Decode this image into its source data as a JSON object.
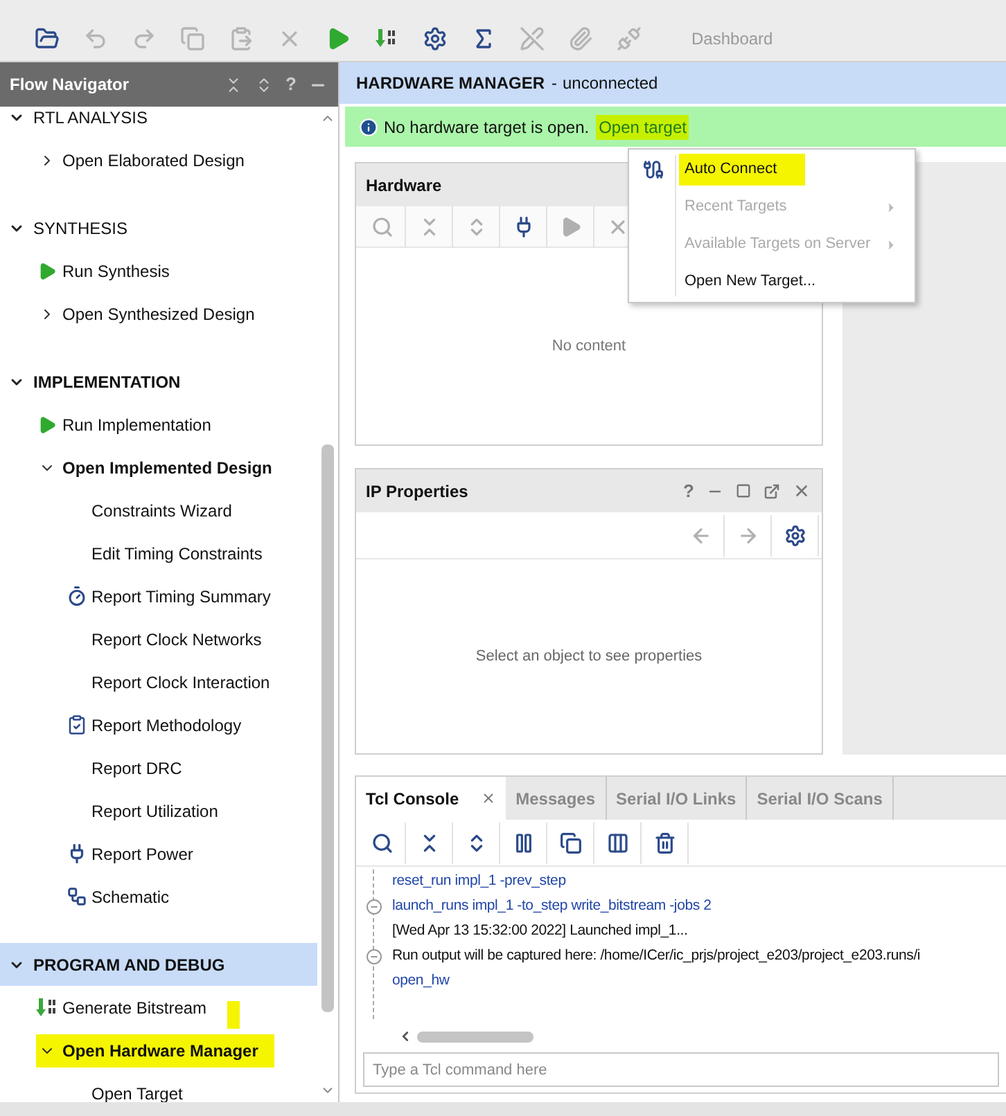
{
  "toolbar": {
    "buttons": [
      {
        "kind": "open",
        "disabled": false
      },
      {
        "kind": "undo",
        "disabled": true
      },
      {
        "kind": "redo",
        "disabled": true
      },
      {
        "kind": "copy",
        "disabled": true
      },
      {
        "kind": "paste",
        "disabled": true
      },
      {
        "kind": "delete",
        "disabled": true
      },
      {
        "kind": "run",
        "disabled": false
      },
      {
        "kind": "bitstream",
        "disabled": false
      },
      {
        "kind": "settings",
        "disabled": false
      },
      {
        "kind": "sum",
        "disabled": false
      },
      {
        "kind": "probe",
        "disabled": true
      },
      {
        "kind": "attach",
        "disabled": true
      },
      {
        "kind": "unplug",
        "disabled": true
      }
    ],
    "layout": "Dashboard"
  },
  "flow_navigator": {
    "title": "Flow Navigator",
    "help": "?",
    "sections": [
      {
        "label": "RTL ANALYSIS",
        "expanded": true,
        "active": false,
        "selected": false,
        "items": [
          {
            "label": "Open Elaborated Design",
            "kind": "group",
            "expanded": false,
            "active": false,
            "highlighted": false
          }
        ]
      },
      {
        "label": "SYNTHESIS",
        "expanded": true,
        "active": false,
        "selected": false,
        "items": [
          {
            "label": "Run Synthesis",
            "kind": "run",
            "active": false,
            "highlighted": false
          },
          {
            "label": "Open Synthesized Design",
            "kind": "group",
            "expanded": false,
            "active": false,
            "highlighted": false
          }
        ]
      },
      {
        "label": "IMPLEMENTATION",
        "expanded": true,
        "active": true,
        "selected": false,
        "items": [
          {
            "label": "Run Implementation",
            "kind": "run",
            "active": false,
            "highlighted": false
          },
          {
            "label": "Open Implemented Design",
            "kind": "group",
            "expanded": true,
            "active": true,
            "highlighted": false,
            "children": [
              {
                "label": "Constraints Wizard",
                "kind": "plain"
              },
              {
                "label": "Edit Timing Constraints",
                "kind": "plain"
              },
              {
                "label": "Report Timing Summary",
                "kind": "timing"
              },
              {
                "label": "Report Clock Networks",
                "kind": "plain"
              },
              {
                "label": "Report Clock Interaction",
                "kind": "plain"
              },
              {
                "label": "Report Methodology",
                "kind": "methodology"
              },
              {
                "label": "Report DRC",
                "kind": "plain"
              },
              {
                "label": "Report Utilization",
                "kind": "plain"
              },
              {
                "label": "Report Power",
                "kind": "power"
              },
              {
                "label": "Schematic",
                "kind": "schematic"
              }
            ]
          }
        ]
      },
      {
        "label": "PROGRAM AND DEBUG",
        "expanded": true,
        "active": true,
        "selected": true,
        "items": [
          {
            "label": "Generate Bitstream",
            "kind": "bitstream",
            "active": false,
            "highlighted": false,
            "marked": true
          },
          {
            "label": "Open Hardware Manager",
            "kind": "group",
            "expanded": true,
            "active": true,
            "highlighted": true,
            "children": [
              {
                "label": "Open Target",
                "kind": "plain"
              }
            ]
          }
        ]
      }
    ]
  },
  "hardware_manager": {
    "title": "HARDWARE MANAGER",
    "separator": "-",
    "status": "unconnected",
    "info": {
      "message": "No hardware target is open.",
      "link": "Open target",
      "highlighted": true
    }
  },
  "target_menu": {
    "items": [
      {
        "label": "Auto Connect",
        "kind": "connect",
        "disabled": false,
        "submenu": false,
        "highlighted": true
      },
      {
        "label": "Recent Targets",
        "kind": "plain",
        "disabled": true,
        "submenu": true,
        "highlighted": false
      },
      {
        "label": "Available Targets on Server",
        "kind": "plain",
        "disabled": true,
        "submenu": true,
        "highlighted": false
      },
      {
        "label": "Open New Target...",
        "kind": "plain",
        "disabled": false,
        "submenu": false,
        "highlighted": false
      }
    ]
  },
  "hardware_panel": {
    "title": "Hardware",
    "tools": [
      {
        "kind": "search",
        "disabled": true
      },
      {
        "kind": "collapse",
        "disabled": true
      },
      {
        "kind": "expand",
        "disabled": true
      },
      {
        "kind": "connect",
        "disabled": false
      },
      {
        "kind": "play",
        "disabled": true
      },
      {
        "kind": "close",
        "disabled": true
      }
    ],
    "empty": "No content"
  },
  "ip_panel": {
    "title": "IP Properties",
    "help": "?",
    "tools": [
      {
        "kind": "back",
        "disabled": true
      },
      {
        "kind": "forward",
        "disabled": true
      },
      {
        "kind": "settings",
        "disabled": false
      }
    ],
    "empty": "Select an object to see properties"
  },
  "console": {
    "tabs": [
      {
        "label": "Tcl Console",
        "selected": true,
        "closable": true
      },
      {
        "label": "Messages",
        "selected": false,
        "closable": false
      },
      {
        "label": "Serial I/O Links",
        "selected": false,
        "closable": false
      },
      {
        "label": "Serial I/O Scans",
        "selected": false,
        "closable": false
      }
    ],
    "tools": [
      {
        "kind": "search"
      },
      {
        "kind": "collapse"
      },
      {
        "kind": "expand"
      },
      {
        "kind": "pause"
      },
      {
        "kind": "copy"
      },
      {
        "kind": "columns"
      },
      {
        "kind": "delete"
      }
    ],
    "lines": [
      {
        "text": "reset_run impl_1 -prev_step",
        "kind": "command",
        "fold": false
      },
      {
        "text": "launch_runs impl_1 -to_step write_bitstream -jobs 2",
        "kind": "command",
        "fold": true
      },
      {
        "text": "[Wed Apr 13 15:32:00 2022] Launched impl_1...",
        "kind": "output",
        "fold": false
      },
      {
        "text": "Run output will be captured here: /home/ICer/ic_prjs/project_e203/project_e203.runs/i",
        "kind": "output",
        "fold": true
      },
      {
        "text": "open_hw",
        "kind": "command",
        "fold": false
      }
    ],
    "placeholder": "Type a Tcl command here"
  }
}
